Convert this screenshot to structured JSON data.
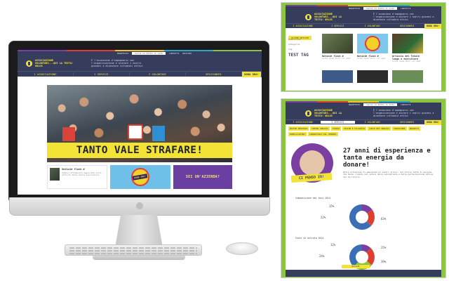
{
  "site": {
    "brand": "ASSOCIAZIONE VOLONTARI...QUI LA TESTA!  ONLUS",
    "tagline": "È l'occasione d'impegnarsi con l'organizzazione e aiutare i nostri giovani a diventare cittadini attivi",
    "util": {
      "link1": "MANIFESTO",
      "search_placeholder": "Cerca in tutto il sito",
      "link2": "CONTATTI",
      "link3": "NOTIZIE"
    },
    "nav": [
      "I ASSOCIAZIONE",
      "I SERVIZI",
      "I VOLONTARI",
      "GRIGIONERI"
    ],
    "cta": "DONA ORA!",
    "colors": {
      "navy": "#353c5c",
      "yellow": "#f3e337",
      "purple": "#6a3fa1",
      "green": "#8cc63f"
    }
  },
  "home": {
    "hero_banner": "TANTO VALE STRAFARE!",
    "card1": {
      "title": "Notizie flash #",
      "body": "Sempre informazioni aggiornate sulle attività della nostra associazione"
    },
    "card2": {
      "badge": "DONA ORA!"
    },
    "card3": {
      "label": "SEI UN'AZIENDA?"
    }
  },
  "news_page": {
    "crumb": "ULTIME NOTIZIE",
    "side": {
      "label1": "Pubblicato",
      "label2": "Categoria",
      "label3": "Tag",
      "big": "TEST TAG"
    },
    "tiles": [
      {
        "title": "Notizie flash #",
        "body": "Lorem ipsum dolor sit amet"
      },
      {
        "title": "Notizie flash #",
        "body": "Lorem ipsum dolor sit amet"
      },
      {
        "title": "Articolo del Totale lungo e esercitare",
        "body": "Lorem ipsum dolor sit amet"
      }
    ]
  },
  "about_page": {
    "subnav": [
      "NOSTRO PERCORSO",
      "CENTRO SERVIZI",
      "STORIA",
      "VISION E FILOSOFIA",
      "CARTA DEI SERVIZI",
      "CONSULENZE",
      "PROGETTI",
      "PUBBLICAZIONI",
      "LABORATORIO DEL VENERDÌ"
    ],
    "feature_label": "CI PENSO IO!",
    "headline": "27 anni di esperienza e tanta energia da donare!",
    "paragraph": "Dalla situazione di emergenza ai nostri giorni: una storia fatta di persone che hanno creduto nel valore della solidarietà e della partecipazione attiva nel territorio.",
    "stat1": {
      "title": "Composizione dei soci 2014",
      "values": [
        15,
        22,
        63
      ]
    },
    "stat2": {
      "title": "Fonti di entrata 2014",
      "values": [
        12,
        24,
        25,
        39
      ]
    },
    "footer_btn": "NOTIZIE"
  }
}
